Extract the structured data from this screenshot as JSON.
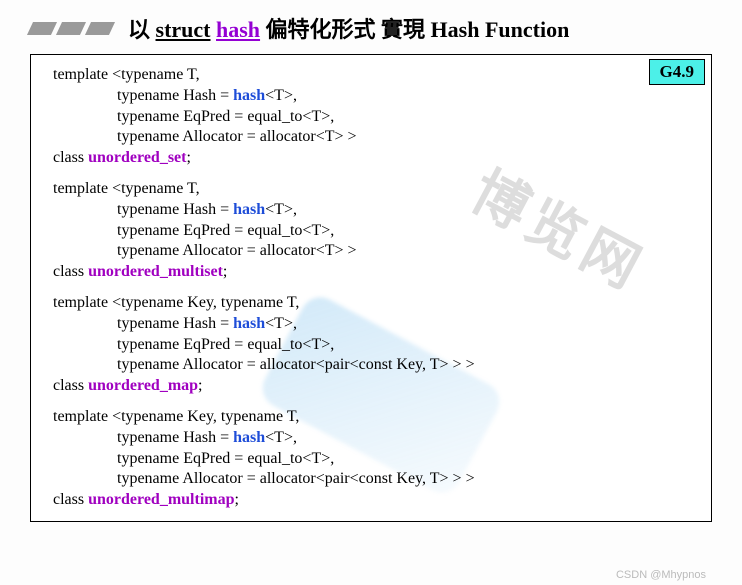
{
  "title": {
    "prefix": "以 ",
    "struct": "struct",
    "space1": " ",
    "hash": "hash",
    "suffix": " 偏特化形式 實現 Hash Function"
  },
  "badge": "G4.9",
  "blocks": [
    {
      "line1_a": "template <typename T,",
      "line2_a": "typename Hash = ",
      "line2_hash": "hash",
      "line2_b": "<T>,",
      "line3": "typename EqPred = equal_to<T>,",
      "line4": "typename Allocator = allocator<T> >",
      "class_kw": "class",
      "classname": "unordered_set",
      "semi": ";"
    },
    {
      "line1_a": "template <typename T,",
      "line2_a": "typename Hash = ",
      "line2_hash": "hash",
      "line2_b": "<T>,",
      "line3": "typename EqPred = equal_to<T>,",
      "line4": "typename Allocator = allocator<T> >",
      "class_kw": "class",
      "classname": "unordered_multiset",
      "semi": ";"
    },
    {
      "line1_a": "template <typename Key, typename T,",
      "line2_a": "typename Hash = ",
      "line2_hash": "hash",
      "line2_b": "<T>,",
      "line3": "typename EqPred = equal_to<T>,",
      "line4": "typename Allocator = allocator<pair<const Key, T> > >",
      "class_kw": "class",
      "classname": "unordered_map",
      "semi": ";"
    },
    {
      "line1_a": "template <typename Key, typename T,",
      "line2_a": "typename Hash = ",
      "line2_hash": "hash",
      "line2_b": "<T>,",
      "line3": "typename EqPred = equal_to<T>,",
      "line4": "typename Allocator = allocator<pair<const Key, T> > >",
      "class_kw": "class",
      "classname": "unordered_multimap",
      "semi": ";"
    }
  ],
  "watermark_text": "博览网",
  "credit": "CSDN @Mhypnos"
}
